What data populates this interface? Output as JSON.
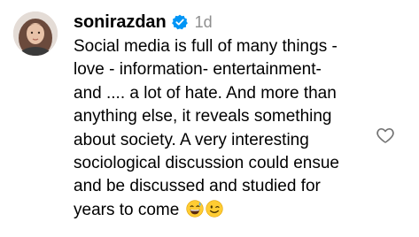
{
  "comment": {
    "username": "sonirazdan",
    "time_ago": "1d",
    "text": "Social media is full of many things -\nlove - information- entertainment-\nand .... a lot of hate. And more than\nanything else, it reveals something\nabout society. A very interesting\nsociological discussion could ensue\nand be discussed and studied for\nyears to come ",
    "emojis": [
      "grinning-sweat-emoji",
      "winking-face-emoji"
    ],
    "verified_icon": "verified-badge-icon",
    "like_icon": "heart-outline-icon"
  },
  "colors": {
    "verified_blue": "#0095f6",
    "muted_gray": "#8e8e8e",
    "emoji_yellow": "#ffcc33"
  }
}
